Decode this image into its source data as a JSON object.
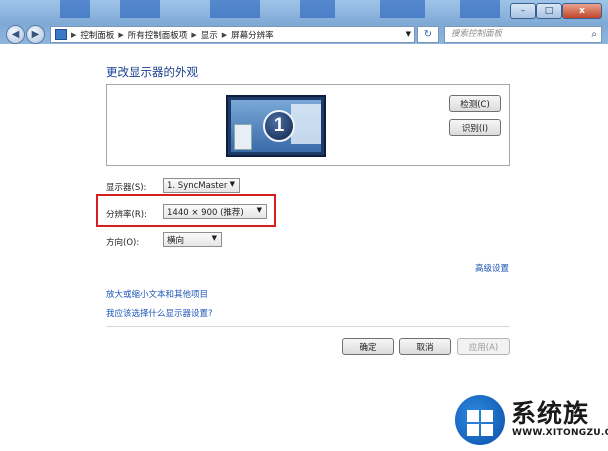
{
  "titlebar": {
    "minimize": "–",
    "maximize": "□",
    "close": "x"
  },
  "nav": {
    "back": "◀",
    "forward": "▶",
    "breadcrumbs": [
      "控制面板",
      "所有控制面板项",
      "显示",
      "屏幕分辨率"
    ],
    "search_placeholder": "搜索控制面板"
  },
  "main": {
    "heading": "更改显示器的外观",
    "monitor_number": "1",
    "detect_button": "检测(C)",
    "identify_button": "识别(I)",
    "display_label": "显示器(S):",
    "display_value": "1. SyncMaster",
    "resolution_label": "分辨率(R):",
    "resolution_value": "1440 × 900 (推荐)",
    "orientation_label": "方向(O):",
    "orientation_value": "横向",
    "advanced_link": "高级设置",
    "link_text_size": "放大或缩小文本和其他项目",
    "link_which_settings": "我应该选择什么显示器设置?",
    "ok_button": "确定",
    "cancel_button": "取消",
    "apply_button": "应用(A)"
  },
  "watermark": {
    "brand": "系统族",
    "url": "WWW.XITONGZU.COM"
  },
  "colors": {
    "highlight": "#d62020",
    "link": "#1d56b8",
    "heading": "#1a3f8f"
  }
}
